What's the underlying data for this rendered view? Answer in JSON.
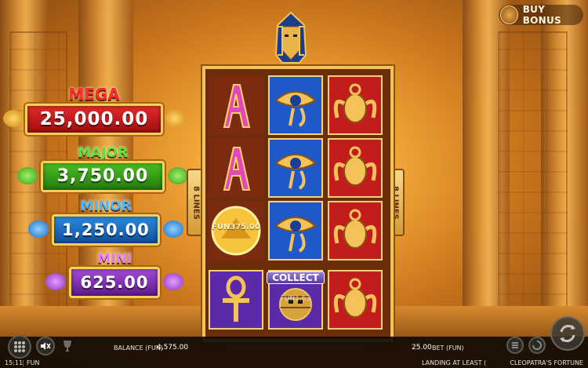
{
  "buy_bonus": {
    "label": "BUY BONUS"
  },
  "jackpots": [
    {
      "name": "MEGA",
      "value": "25,000.00"
    },
    {
      "name": "MAJOR",
      "value": "3,750.00"
    },
    {
      "name": "MINOR",
      "value": "1,250.00"
    },
    {
      "name": "MINI",
      "value": "625.00"
    }
  ],
  "lines_badge": {
    "count": "8",
    "text": "LINES"
  },
  "reels": {
    "coin_value": "FUN375.00",
    "collect_label": "COLLECT",
    "collect_value": "FUN1.63"
  },
  "bottom_bar": {
    "balance_label": "BALANCE (FUN)",
    "balance_value": "4,575.00",
    "bet_value": "25.00",
    "bet_label": "BET (FUN)",
    "clock": "15:11",
    "mode": "FUN",
    "status": "LANDING AT LEAST (",
    "game_title": "CLEOPATRA'S FORTUNE"
  },
  "colors": {
    "mega": "#d21a1a",
    "major": "#3fa21a",
    "minor": "#1a76d0",
    "mini": "#8a2fbf",
    "gold": "#f3c35a"
  }
}
